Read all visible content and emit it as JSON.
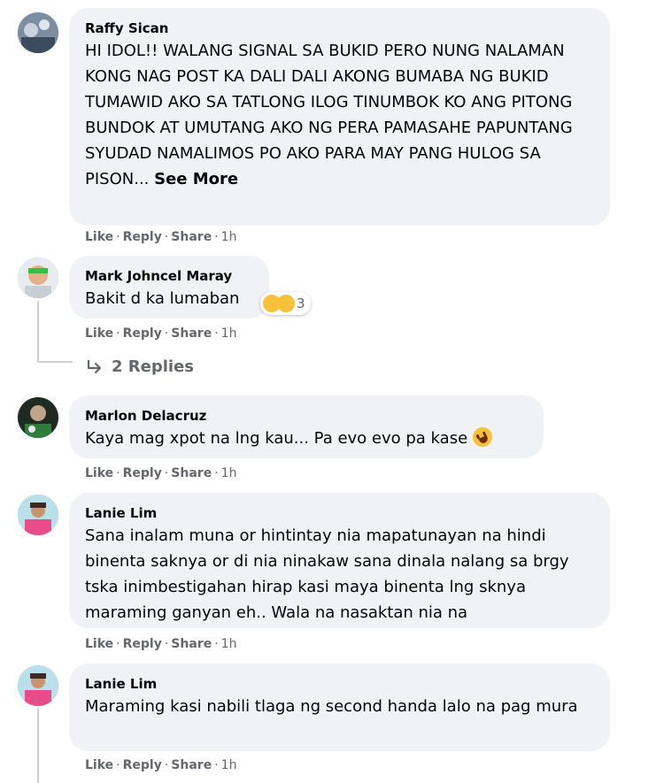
{
  "comments": [
    {
      "author": "Raffy Sican",
      "text": "HI IDOL!! WALANG SIGNAL SA BUKID PERO NUNG NALAMAN KONG NAG POST KA DALI DALI AKONG BUMABA NG BUKID TUMAWID AKO SA TATLONG ILOG TINUMBOK KO ANG PITONG BUNDOK AT UMUTANG AKO NG PERA PAMASAHE PAPUNTANG SYUDAD NAMALIMOS PO AKO PARA MAY PANG HULOG SA PISON...",
      "see_more": "See More",
      "like": "Like",
      "reply": "Reply",
      "share": "Share",
      "time": "1h"
    },
    {
      "author": "Mark Johncel Maray",
      "text": "Bakit d ka lumaban",
      "reaction_count": "3",
      "like": "Like",
      "reply": "Reply",
      "share": "Share",
      "time": "1h",
      "replies_label": "2 Replies"
    },
    {
      "author": "Marlon Delacruz",
      "text": "Kaya mag xpot na lng kau... Pa evo evo pa kase",
      "like": "Like",
      "reply": "Reply",
      "share": "Share",
      "time": "1h"
    },
    {
      "author": "Lanie Lim",
      "text": "Sana inalam muna or hintintay nia mapatunayan na hindi binenta saknya or di nia ninakaw sana dinala nalang sa brgy tska inimbestigahan hirap kasi maya binenta lng sknya maraming ganyan eh.. Wala na nasaktan nia na",
      "like": "Like",
      "reply": "Reply",
      "share": "Share",
      "time": "1h"
    },
    {
      "author": "Lanie Lim",
      "text": "Maraming kasi nabili tlaga ng second handa lalo na pag mura",
      "like": "Like",
      "reply": "Reply",
      "share": "Share",
      "time": "1h"
    }
  ],
  "dot": "·"
}
